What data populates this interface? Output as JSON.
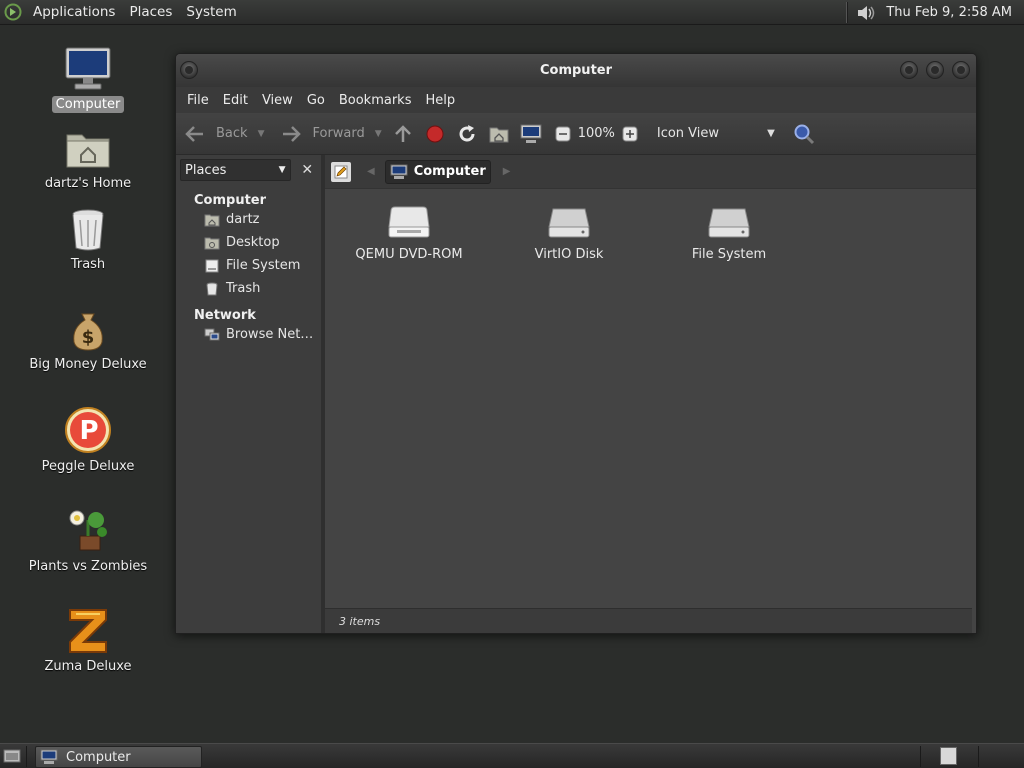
{
  "top_panel": {
    "menus": [
      "Applications",
      "Places",
      "System"
    ],
    "clock": "Thu Feb  9,  2:58 AM"
  },
  "desktop_icons": [
    {
      "label": "Computer",
      "icon": "computer-icon",
      "selected": true
    },
    {
      "label": "dartz's Home",
      "icon": "home-folder-icon"
    },
    {
      "label": "Trash",
      "icon": "trash-icon"
    },
    {
      "label": "Big Money Deluxe",
      "icon": "money-bag-icon"
    },
    {
      "label": "Peggle Deluxe",
      "icon": "peggle-icon"
    },
    {
      "label": "Plants vs Zombies",
      "icon": "plants-vs-zombies-icon"
    },
    {
      "label": "Zuma Deluxe",
      "icon": "zuma-icon"
    }
  ],
  "window": {
    "title": "Computer",
    "menubar": [
      "File",
      "Edit",
      "View",
      "Go",
      "Bookmarks",
      "Help"
    ],
    "toolbar": {
      "back": "Back",
      "forward": "Forward",
      "zoom": "100%",
      "view_mode": "Icon View"
    },
    "sidebar": {
      "selector": "Places",
      "groups": [
        {
          "title": "Computer",
          "items": [
            {
              "label": "dartz",
              "icon": "home-icon"
            },
            {
              "label": "Desktop",
              "icon": "desktop-icon"
            },
            {
              "label": "File System",
              "icon": "filesystem-icon"
            },
            {
              "label": "Trash",
              "icon": "trash-icon"
            }
          ]
        },
        {
          "title": "Network",
          "items": [
            {
              "label": "Browse Net…",
              "icon": "network-icon"
            }
          ]
        }
      ]
    },
    "pathbar": {
      "crumb": "Computer"
    },
    "files": [
      {
        "label": "QEMU DVD-ROM",
        "icon": "optical-drive-icon"
      },
      {
        "label": "VirtIO Disk",
        "icon": "hard-disk-icon"
      },
      {
        "label": "File System",
        "icon": "hard-disk-icon"
      }
    ],
    "status": "3 items"
  },
  "bottom_panel": {
    "task": "Computer"
  }
}
